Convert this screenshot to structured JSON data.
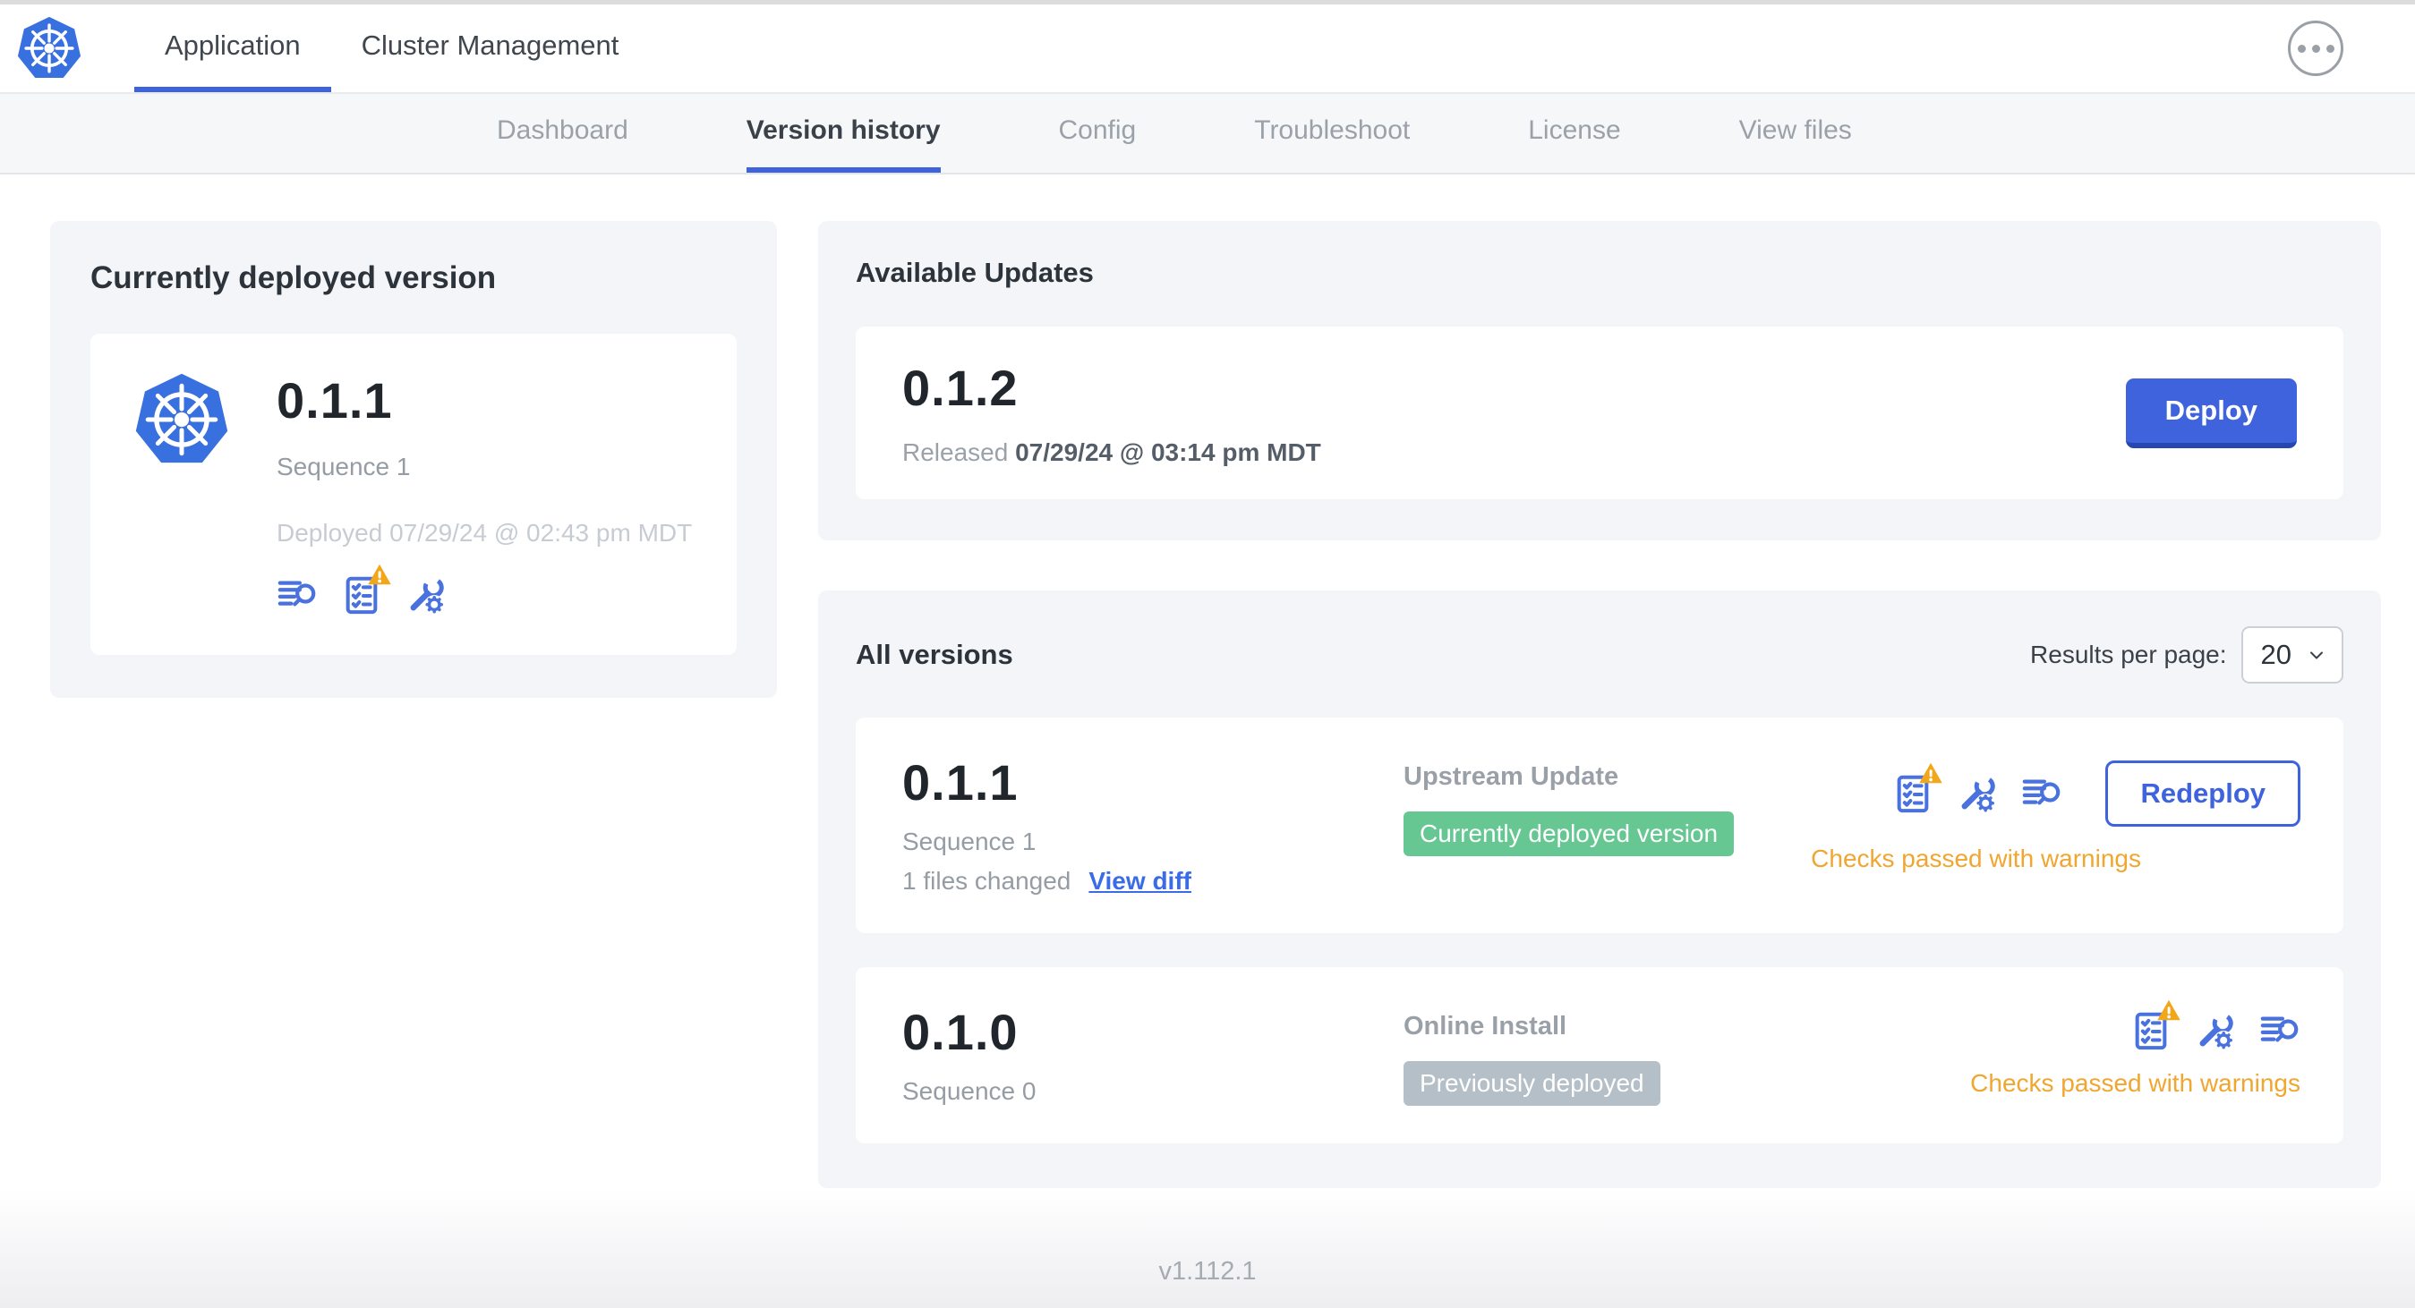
{
  "header": {
    "tabs": [
      {
        "label": "Application"
      },
      {
        "label": "Cluster Management"
      }
    ]
  },
  "subnav": {
    "tabs": [
      {
        "label": "Dashboard"
      },
      {
        "label": "Version history"
      },
      {
        "label": "Config"
      },
      {
        "label": "Troubleshoot"
      },
      {
        "label": "License"
      },
      {
        "label": "View files"
      }
    ]
  },
  "deployed_card": {
    "title": "Currently deployed version",
    "version": "0.1.1",
    "sequence": "Sequence 1",
    "deployed": "Deployed 07/29/24 @ 02:43 pm MDT"
  },
  "available_updates": {
    "title": "Available Updates",
    "version": "0.1.2",
    "released_prefix": "Released ",
    "released_date": "07/29/24 @ 03:14 pm MDT",
    "deploy_label": "Deploy"
  },
  "all_versions": {
    "title": "All versions",
    "results_per_page_label": "Results per page:",
    "results_per_page_value": "20",
    "rows": [
      {
        "version": "0.1.1",
        "sequence": "Sequence 1",
        "files_changed": "1 files changed",
        "view_diff_label": "View diff",
        "source": "Upstream Update",
        "badge": "Currently deployed version",
        "badge_type": "green",
        "checks": "Checks passed with warnings",
        "action_label": "Redeploy"
      },
      {
        "version": "0.1.0",
        "sequence": "Sequence 0",
        "source": "Online Install",
        "badge": "Previously deployed",
        "badge_type": "gray",
        "checks": "Checks passed with warnings"
      }
    ]
  },
  "footer": {
    "version": "v1.112.1"
  },
  "colors": {
    "accent_blue": "#3e63dd",
    "logo_blue": "#3870e0",
    "badge_green": "#67c793",
    "badge_gray": "#b4bfc7",
    "warning_orange": "#f0a62f"
  },
  "icons": {
    "logo": "kubernetes-logo",
    "menu": "ellipsis-menu-icon",
    "release_notes": "release-notes-icon",
    "preflight": "preflight-checks-icon",
    "config": "config-wrench-icon",
    "warning": "warning-triangle-icon"
  }
}
